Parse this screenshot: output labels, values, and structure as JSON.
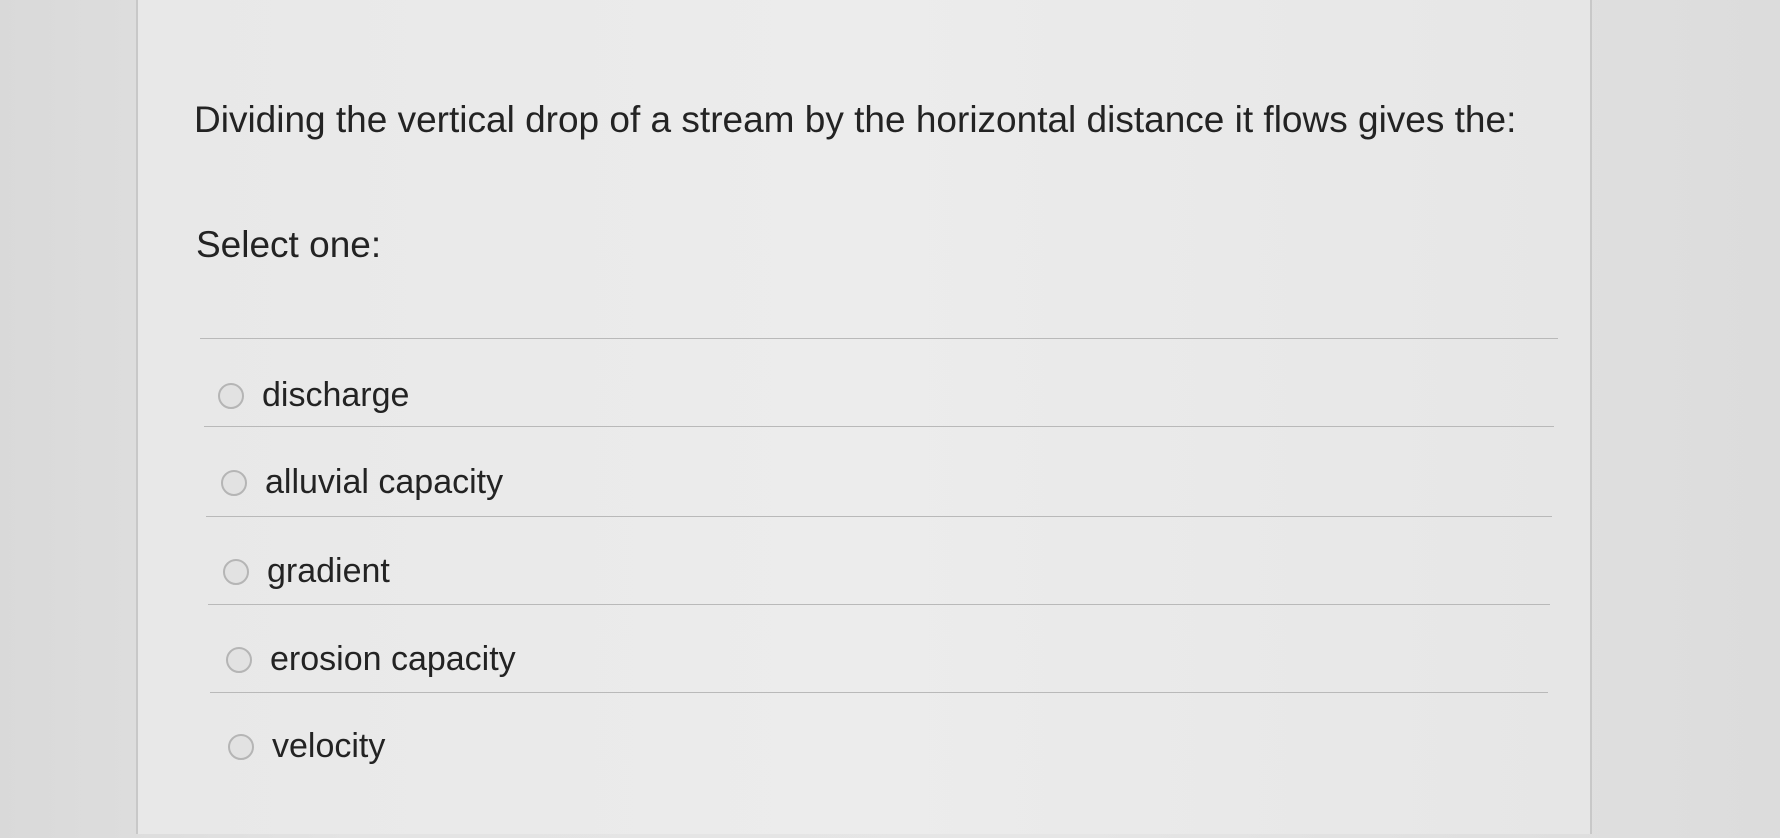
{
  "question": {
    "text": "Dividing the vertical drop of a stream by the horizontal distance it flows gives the:",
    "instruction": "Select one:"
  },
  "options": [
    {
      "label": "discharge",
      "selected": false
    },
    {
      "label": "alluvial capacity",
      "selected": false
    },
    {
      "label": "gradient",
      "selected": false
    },
    {
      "label": "erosion capacity",
      "selected": false
    },
    {
      "label": "velocity",
      "selected": false
    }
  ]
}
